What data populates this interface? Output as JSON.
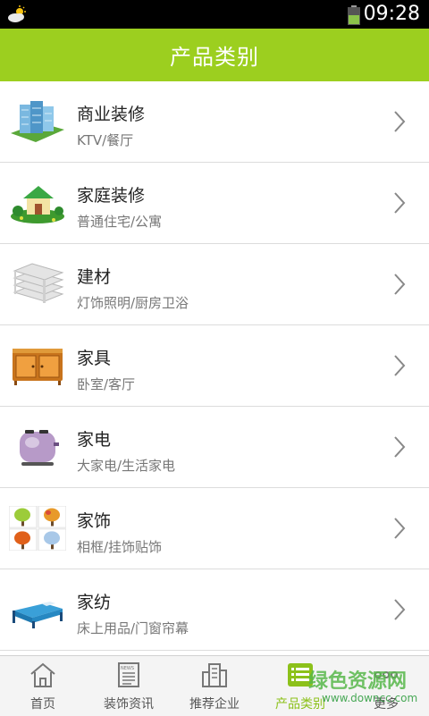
{
  "status_bar": {
    "time": "09:28",
    "weather_icon": "partly-cloudy-icon",
    "battery_icon": "battery-icon"
  },
  "header": {
    "title": "产品类别"
  },
  "categories": [
    {
      "name": "商业装修",
      "sub": "KTV/餐厅",
      "icon": "office-buildings-icon"
    },
    {
      "name": "家庭装修",
      "sub": "普通住宅/公寓",
      "icon": "house-icon"
    },
    {
      "name": "建材",
      "sub": "灯饰照明/厨房卫浴",
      "icon": "building-materials-icon"
    },
    {
      "name": "家具",
      "sub": "卧室/客厅",
      "icon": "cabinet-icon"
    },
    {
      "name": "家电",
      "sub": "大家电/生活家电",
      "icon": "toaster-icon"
    },
    {
      "name": "家饰",
      "sub": "相框/挂饰贴饰",
      "icon": "trees-decor-icon"
    },
    {
      "name": "家纺",
      "sub": "床上用品/门窗帘幕",
      "icon": "bed-icon"
    }
  ],
  "tabs": [
    {
      "label": "首页",
      "icon": "home-icon"
    },
    {
      "label": "装饰资讯",
      "icon": "news-icon"
    },
    {
      "label": "推荐企业",
      "icon": "buildings-icon"
    },
    {
      "label": "产品类别",
      "icon": "list-icon"
    },
    {
      "label": "更多",
      "icon": "more-icon"
    }
  ],
  "active_tab": "产品类别",
  "watermark": {
    "text": "绿色资源网",
    "url": "www.downcc.com"
  },
  "colors": {
    "accent": "#9ccf1f",
    "active_tab": "#8cc11a",
    "status_bar": "#000000"
  }
}
